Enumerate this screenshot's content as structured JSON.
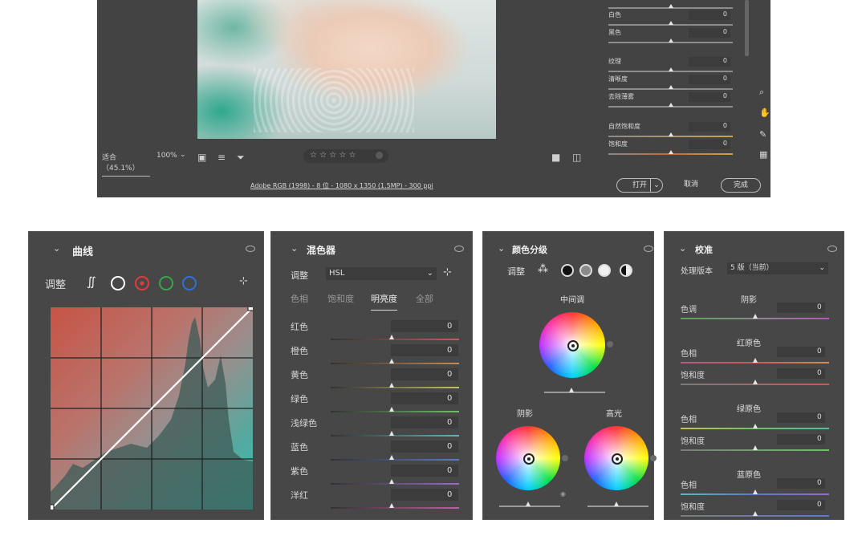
{
  "top": {
    "sliders": [
      {
        "label": "白色",
        "value": "0"
      },
      {
        "label": "黑色",
        "value": "0"
      },
      {
        "label": "纹理",
        "value": "0"
      },
      {
        "label": "清晰度",
        "value": "0"
      },
      {
        "label": "去除薄雾",
        "value": "0"
      },
      {
        "label": "自然饱和度",
        "value": "0"
      },
      {
        "label": "饱和度",
        "value": "0"
      }
    ],
    "zoom_fit": "适合（45.1%）",
    "zoom_pct": "100%",
    "rating_stars": "☆ ☆ ☆ ☆ ☆",
    "footer_info": "Adobe RGB (1998) - 8 位 - 1080 x 1350 (1.5MP) - 300 ppi",
    "open_label": "打开",
    "cancel_label": "取消",
    "done_label": "完成"
  },
  "curves": {
    "title": "曲线",
    "adjust_label": "调整"
  },
  "mixer": {
    "title": "混色器",
    "adjust_label": "调整",
    "adjust_value": "HSL",
    "tabs": [
      "色相",
      "饱和度",
      "明亮度",
      "全部"
    ],
    "rows": [
      {
        "label": "红色",
        "value": "0",
        "color": "#c85a5a"
      },
      {
        "label": "橙色",
        "value": "0",
        "color": "#c88a50"
      },
      {
        "label": "黄色",
        "value": "0",
        "color": "#c8c060"
      },
      {
        "label": "绿色",
        "value": "0",
        "color": "#6fbf6a"
      },
      {
        "label": "浅绿色",
        "value": "0",
        "color": "#5ab8b8"
      },
      {
        "label": "蓝色",
        "value": "0",
        "color": "#5a7ac8"
      },
      {
        "label": "紫色",
        "value": "0",
        "color": "#9a6ac8"
      },
      {
        "label": "洋红",
        "value": "0",
        "color": "#c85aa0"
      }
    ]
  },
  "grading": {
    "title": "颜色分级",
    "adjust_label": "调整",
    "midtones_label": "中间调",
    "shadows_label": "阴影",
    "highlights_label": "高光"
  },
  "calib": {
    "title": "校准",
    "version_label": "处理版本",
    "version_value": "5 版（当前）",
    "shadow_head": "阴影",
    "shadow_rows": [
      {
        "label": "色调",
        "value": "0"
      }
    ],
    "red_head": "红原色",
    "red_rows": [
      {
        "label": "色相",
        "value": "0"
      },
      {
        "label": "饱和度",
        "value": "0"
      }
    ],
    "green_head": "绿原色",
    "green_rows": [
      {
        "label": "色相",
        "value": "0"
      },
      {
        "label": "饱和度",
        "value": "0"
      }
    ],
    "blue_head": "蓝原色",
    "blue_rows": [
      {
        "label": "色相",
        "value": "0"
      },
      {
        "label": "饱和度",
        "value": "0"
      }
    ]
  }
}
